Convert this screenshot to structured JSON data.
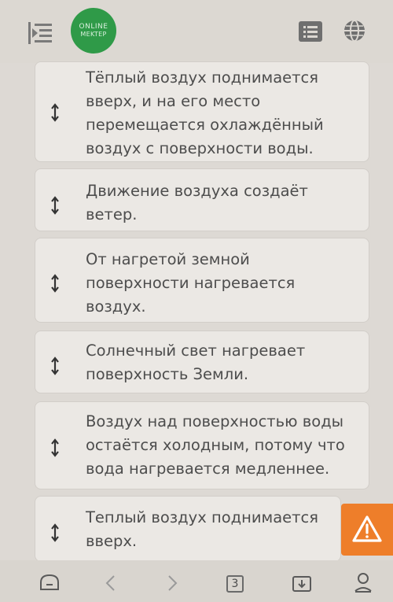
{
  "header": {
    "logo_line1": "ONLINE",
    "logo_line2": "MEKTEP"
  },
  "cards": [
    {
      "text": "Тёплый воздух поднимается вверх, и на его место перемещается охлаждённый воздух с поверхности воды."
    },
    {
      "text": "Движение воздуха создаёт ветер."
    },
    {
      "text": "От нагретой земной поверхности нагревается воздух."
    },
    {
      "text": "Солнечный свет нагревает поверхность Земли."
    },
    {
      "text": "Воздух над поверхностью воды остаётся холодным, потому что вода нагревается медленнее."
    },
    {
      "text": "Теплый воздух поднимается вверх."
    }
  ],
  "browser": {
    "tab_count": "3"
  },
  "colors": {
    "brand_green": "#2f9a48",
    "warning_orange": "#ee7e2a",
    "card_bg": "#ebe8e4"
  }
}
